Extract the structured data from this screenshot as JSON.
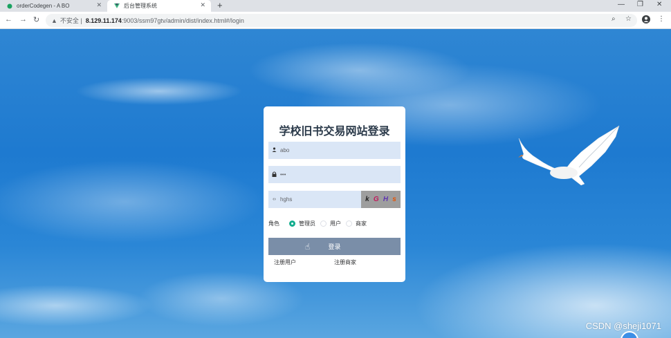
{
  "browser": {
    "tabs": [
      {
        "title": "orderCodegen - A BO",
        "active": false
      },
      {
        "title": "后台管理系统",
        "active": true
      }
    ],
    "url": {
      "security_label": "不安全",
      "host": "8.129.11.174",
      "path": ":9003/ssm97gtv/admin/dist/index.html#/login"
    }
  },
  "login": {
    "title": "学校旧书交易网站登录",
    "username_value": "abo",
    "password_value": "•••",
    "captcha_input_value": "hghs",
    "captcha_chars": [
      {
        "char": "k",
        "color": "#222222"
      },
      {
        "char": "G",
        "color": "#c2185b"
      },
      {
        "char": "H",
        "color": "#5e35b1"
      },
      {
        "char": "s",
        "color": "#e65100"
      }
    ],
    "role_label": "角色",
    "roles": [
      {
        "label": "管理员",
        "selected": true
      },
      {
        "label": "用户",
        "selected": false
      },
      {
        "label": "商家",
        "selected": false
      }
    ],
    "login_button": "登录",
    "register_user": "注册用户",
    "register_merchant": "注册商家"
  },
  "watermark": "CSDN @sheji1071",
  "colors": {
    "field_bg": "#dae6f6",
    "button_bg": "#7a8ea8",
    "radio_accent": "#13ad8e"
  }
}
